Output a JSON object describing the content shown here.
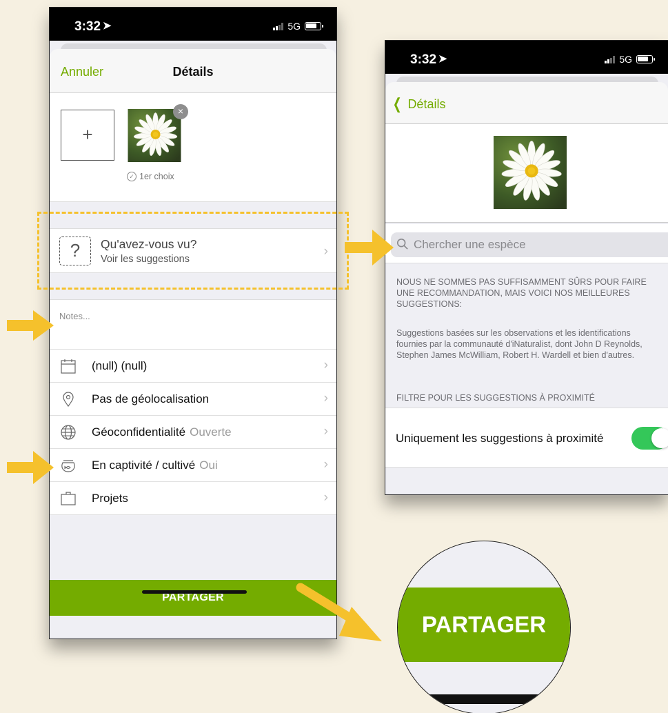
{
  "left_screen": {
    "status": {
      "time": "3:32",
      "network": "5G"
    },
    "nav": {
      "cancel": "Annuler",
      "title": "Détails"
    },
    "photos": {
      "add_symbol": "+",
      "remove_symbol": "×",
      "first_choice": "1er choix"
    },
    "what_seen": {
      "title": "Qu'avez-vous vu?",
      "subtitle": "Voir les suggestions"
    },
    "notes_placeholder": "Notes...",
    "rows": [
      {
        "icon": "calendar-icon",
        "label": "(null) (null)",
        "value": ""
      },
      {
        "icon": "location-pin-icon",
        "label": "Pas de géolocalisation",
        "value": ""
      },
      {
        "icon": "globe-icon",
        "label": "Géoconfidentialité",
        "value": "Ouverte"
      },
      {
        "icon": "fishbowl-icon",
        "label": "En captivité / cultivé",
        "value": "Oui"
      },
      {
        "icon": "briefcase-icon",
        "label": "Projets",
        "value": ""
      }
    ],
    "share_button": "PARTAGER"
  },
  "right_screen": {
    "status": {
      "time": "3:32",
      "network": "5G"
    },
    "nav": {
      "back": "Détails"
    },
    "search_placeholder": "Chercher une espèce",
    "notice_heading": "NOUS NE SOMMES PAS SUFFISAMMENT SÛRS POUR FAIRE UNE RECOMMANDATION, MAIS VOICI NOS MEILLEURES SUGGESTIONS:",
    "notice_body": "Suggestions basées sur les observations et les identifications fournies par la communauté d'iNaturalist, dont John D Reynolds, Stephen James McWilliam, Robert H. Wardell et bien d'autres.",
    "filter_heading": "FILTRE POUR LES SUGGESTIONS À PROXIMITÉ",
    "nearby_toggle": {
      "label": "Uniquement les suggestions à proximité",
      "on": true
    }
  },
  "zoom": {
    "label": "PARTAGER"
  },
  "colors": {
    "accent": "#74ac00",
    "highlight": "#f5c12c",
    "toggle_on": "#34c759",
    "background": "#f6f0e1"
  }
}
